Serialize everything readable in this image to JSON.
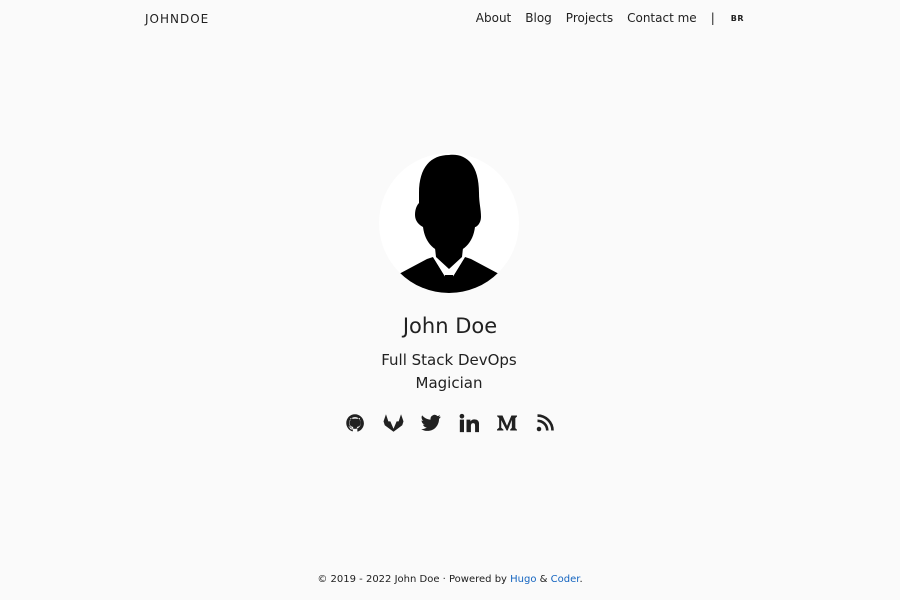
{
  "brand": "JOHNDOE",
  "nav": {
    "links": [
      "About",
      "Blog",
      "Projects",
      "Contact me"
    ],
    "separator": "|",
    "language": "BR"
  },
  "profile": {
    "name": "John Doe",
    "tagline": "Full Stack DevOps Magician"
  },
  "social": {
    "icons": [
      "github-icon",
      "gitlab-icon",
      "twitter-icon",
      "linkedin-icon",
      "medium-icon",
      "rss-icon"
    ]
  },
  "footer": {
    "copyright": "© 2019 - 2022 John Doe · Powered by ",
    "hugo": "Hugo",
    "amp": " & ",
    "coder": "Coder",
    "end": "."
  },
  "colors": {
    "background": "#fafafa",
    "text": "#212121",
    "link": "#1565c0"
  }
}
